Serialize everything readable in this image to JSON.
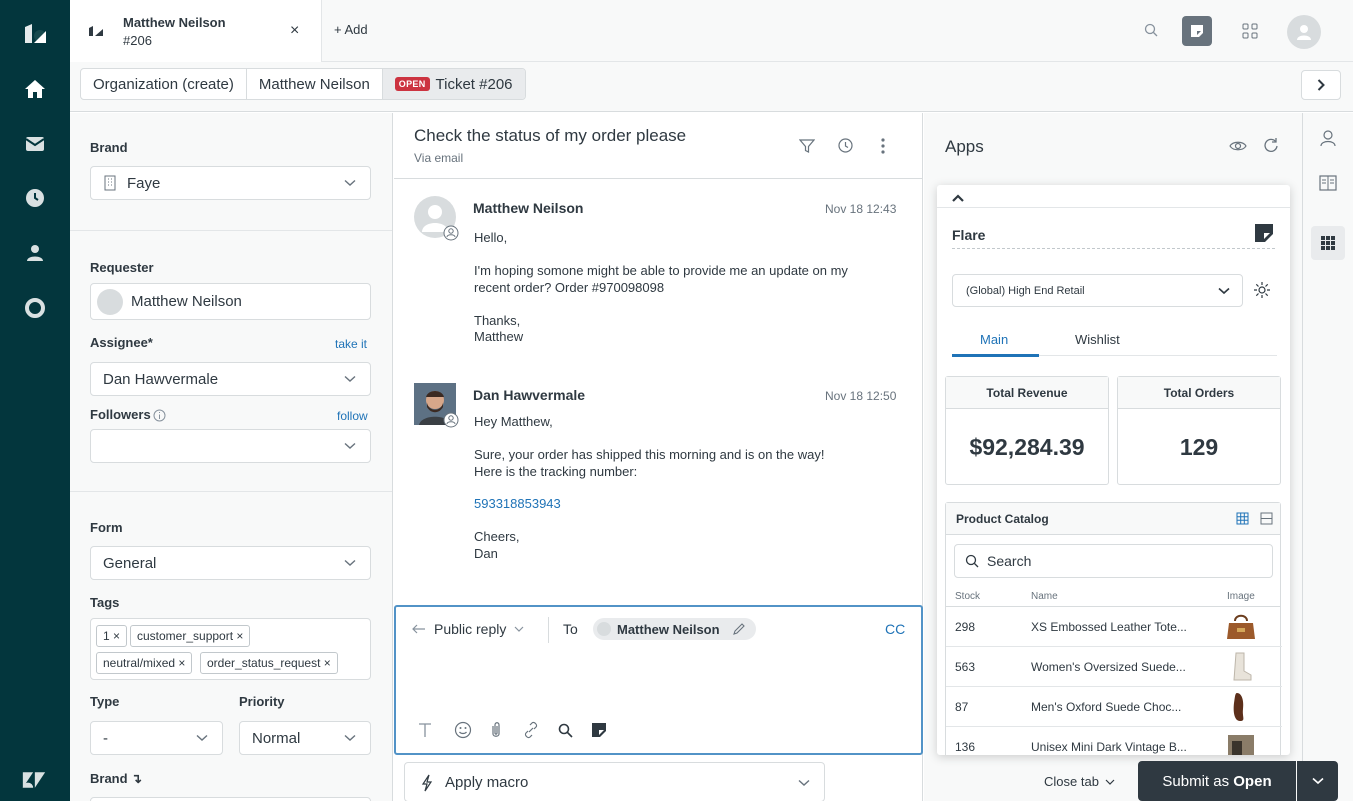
{
  "tab": {
    "name": "Matthew Neilson",
    "number": "#206",
    "close": "×",
    "add": "+ Add"
  },
  "breadcrumb": {
    "org": "Organization (create)",
    "user": "Matthew Neilson",
    "badge": "OPEN",
    "ticket": "Ticket #206"
  },
  "props": {
    "brand_label": "Brand",
    "brand_value": "Faye",
    "requester_label": "Requester",
    "requester_value": "Matthew Neilson",
    "assignee_label": "Assignee*",
    "assignee_link": "take it",
    "assignee_value": "Dan Hawvermale",
    "followers_label": "Followers",
    "followers_link": "follow",
    "form_label": "Form",
    "form_value": "General",
    "tags_label": "Tags",
    "tags": [
      "1",
      "customer_support",
      "neutral/mixed",
      "order_status_request"
    ],
    "type_label": "Type",
    "type_value": "-",
    "priority_label": "Priority",
    "priority_value": "Normal",
    "brand2_label": "Brand ↴"
  },
  "conversation": {
    "subject": "Check the status of my order please",
    "via": "Via email",
    "messages": [
      {
        "author": "Matthew Neilson",
        "time": "Nov 18 12:43",
        "lines": [
          "Hello,",
          "I'm hoping somone might be able to provide me an update on my",
          "recent order? Order #970098098",
          "Thanks,",
          "Matthew"
        ]
      },
      {
        "author": "Dan Hawvermale",
        "time": "Nov 18 12:50",
        "lines": [
          "Hey Matthew,",
          "Sure, your order has shipped this morning and is on the way!",
          "Here is the tracking number:",
          "593318853943",
          "Cheers,",
          "Dan"
        ]
      }
    ],
    "reply_mode": "Public reply",
    "to_label": "To",
    "to_recipient": "Matthew Neilson",
    "cc": "CC",
    "macro": "Apply macro"
  },
  "apps": {
    "title": "Apps",
    "flare": {
      "name": "Flare",
      "store": "(Global) High End Retail",
      "tabs": [
        "Main",
        "Wishlist"
      ],
      "revenue_label": "Total Revenue",
      "revenue_value": "$92,284.39",
      "orders_label": "Total Orders",
      "orders_value": "129",
      "catalog_title": "Product Catalog",
      "search_placeholder": "Search",
      "columns": [
        "Stock",
        "Name",
        "Image"
      ],
      "rows": [
        {
          "stock": "298",
          "name": "XS Embossed Leather Tote..."
        },
        {
          "stock": "563",
          "name": "Women's Oversized Suede..."
        },
        {
          "stock": "87",
          "name": "Men's Oxford Suede Choc..."
        },
        {
          "stock": "136",
          "name": "Unisex Mini Dark Vintage B..."
        }
      ]
    }
  },
  "footer": {
    "close_tab": "Close tab",
    "submit_prefix": "Submit as ",
    "submit_status": "Open"
  },
  "colors": {
    "rail": "#03363d",
    "accent": "#1f73b7",
    "open_badge": "#cc3340",
    "submit": "#2f3941"
  }
}
